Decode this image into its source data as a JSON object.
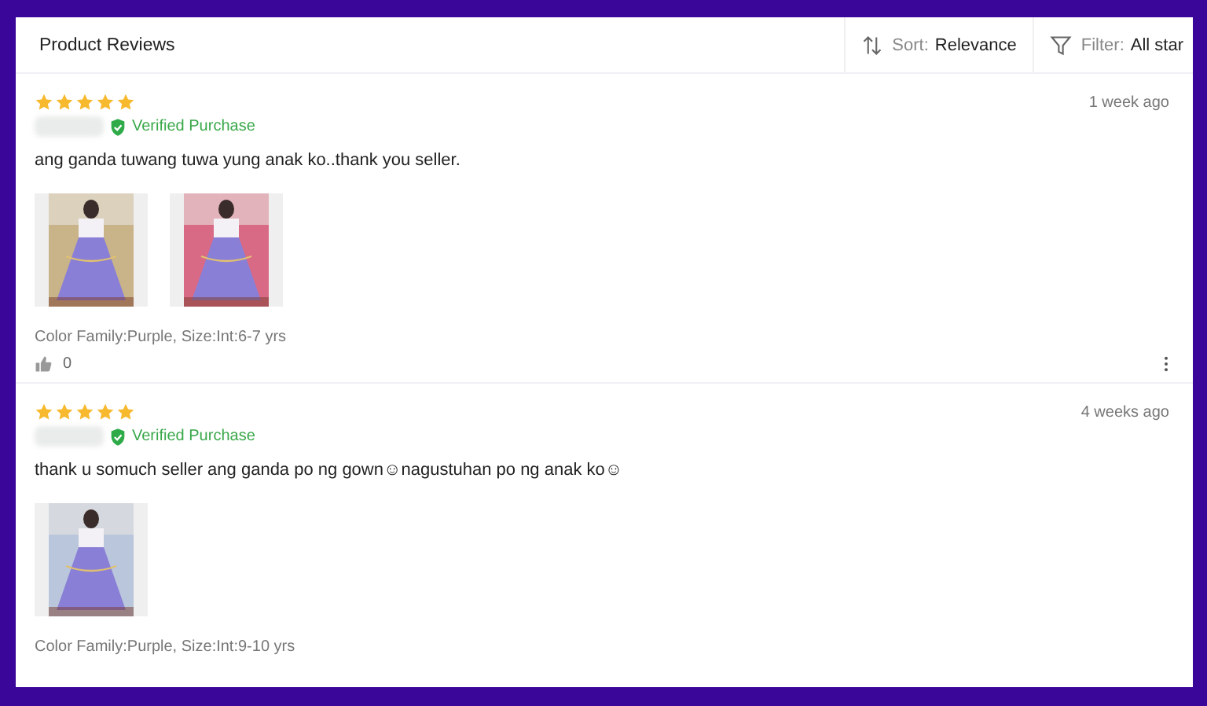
{
  "header": {
    "title": "Product Reviews",
    "sort": {
      "label": "Sort:",
      "value": "Relevance"
    },
    "filter": {
      "label": "Filter:",
      "value": "All star"
    }
  },
  "reviews": [
    {
      "stars": 5,
      "verified": "Verified Purchase",
      "date": "1 week ago",
      "text": "ang ganda tuwang tuwa yung anak ko..thank you seller.",
      "photos": [
        {
          "kind": "picture"
        },
        {
          "kind": "picture"
        }
      ],
      "variant": "Color Family:Purple, Size:Int:6-7 yrs",
      "likes": "0"
    },
    {
      "stars": 5,
      "verified": "Verified Purchase",
      "date": "4 weeks ago",
      "text": "thank u somuch seller ang ganda po ng gown☺nagustuhan po ng anak ko☺",
      "photos": [
        {
          "kind": "picture"
        }
      ],
      "variant": "Color Family:Purple, Size:Int:9-10 yrs"
    }
  ]
}
